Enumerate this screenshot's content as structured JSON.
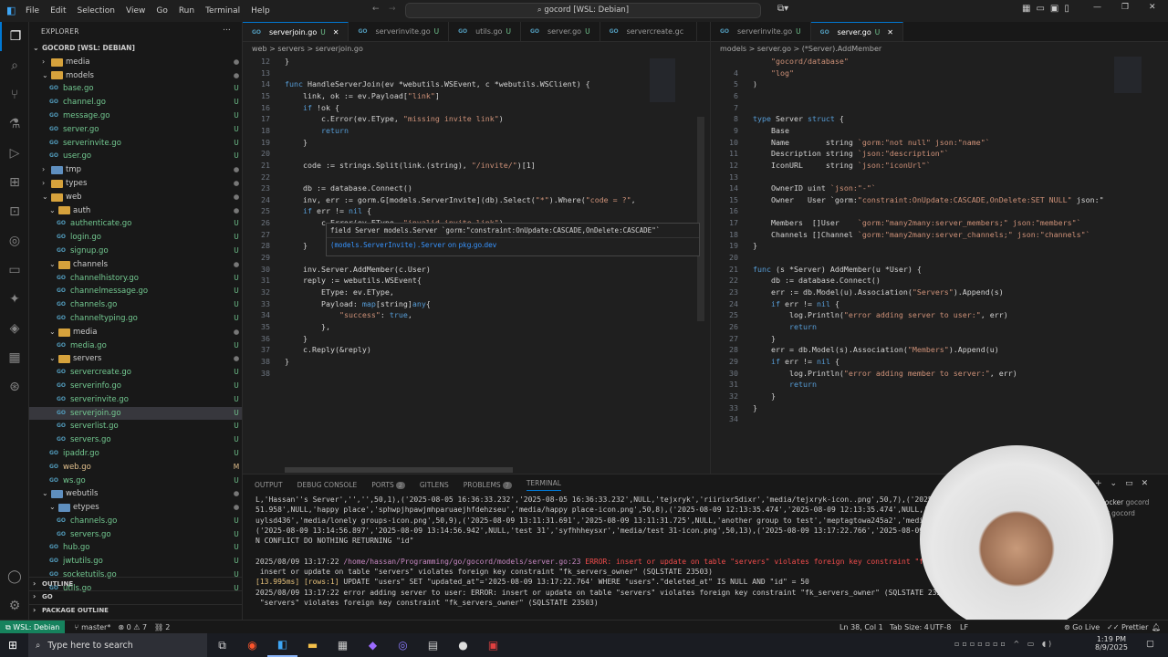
{
  "menu": [
    "File",
    "Edit",
    "Selection",
    "View",
    "Go",
    "Run",
    "Terminal",
    "Help"
  ],
  "search": "gocord [WSL: Debian]",
  "explorer": {
    "title": "EXPLORER",
    "root": "GOCORD [WSL: DEBIAN]",
    "tree": [
      {
        "label": "media",
        "depth": 1,
        "kind": "folder",
        "status": "dot"
      },
      {
        "label": "models",
        "depth": 1,
        "kind": "folder-open",
        "status": "dot"
      },
      {
        "label": "base.go",
        "depth": 2,
        "kind": "go",
        "status": "U"
      },
      {
        "label": "channel.go",
        "depth": 2,
        "kind": "go",
        "status": "U"
      },
      {
        "label": "message.go",
        "depth": 2,
        "kind": "go",
        "status": "U"
      },
      {
        "label": "server.go",
        "depth": 2,
        "kind": "go",
        "status": "U"
      },
      {
        "label": "serverinvite.go",
        "depth": 2,
        "kind": "go",
        "status": "U"
      },
      {
        "label": "user.go",
        "depth": 2,
        "kind": "go",
        "status": "U"
      },
      {
        "label": "tmp",
        "depth": 1,
        "kind": "folder",
        "status": "dot"
      },
      {
        "label": "types",
        "depth": 1,
        "kind": "folder",
        "status": "dot"
      },
      {
        "label": "web",
        "depth": 1,
        "kind": "folder-open",
        "status": "dot"
      },
      {
        "label": "auth",
        "depth": 2,
        "kind": "folder-open",
        "status": "dot"
      },
      {
        "label": "authenticate.go",
        "depth": 3,
        "kind": "go",
        "status": "U"
      },
      {
        "label": "login.go",
        "depth": 3,
        "kind": "go",
        "status": "U"
      },
      {
        "label": "signup.go",
        "depth": 3,
        "kind": "go",
        "status": "U"
      },
      {
        "label": "channels",
        "depth": 2,
        "kind": "folder-open",
        "status": "dot"
      },
      {
        "label": "channelhistory.go",
        "depth": 3,
        "kind": "go",
        "status": "U"
      },
      {
        "label": "channelmessage.go",
        "depth": 3,
        "kind": "go",
        "status": "U"
      },
      {
        "label": "channels.go",
        "depth": 3,
        "kind": "go",
        "status": "U"
      },
      {
        "label": "channeltyping.go",
        "depth": 3,
        "kind": "go",
        "status": "U"
      },
      {
        "label": "media",
        "depth": 2,
        "kind": "folder-open",
        "status": "dot"
      },
      {
        "label": "media.go",
        "depth": 3,
        "kind": "go",
        "status": "U"
      },
      {
        "label": "servers",
        "depth": 2,
        "kind": "folder-open",
        "status": "dot"
      },
      {
        "label": "servercreate.go",
        "depth": 3,
        "kind": "go",
        "status": "U"
      },
      {
        "label": "serverinfo.go",
        "depth": 3,
        "kind": "go",
        "status": "U"
      },
      {
        "label": "serverinvite.go",
        "depth": 3,
        "kind": "go",
        "status": "U"
      },
      {
        "label": "serverjoin.go",
        "depth": 3,
        "kind": "go",
        "status": "U",
        "selected": true
      },
      {
        "label": "serverlist.go",
        "depth": 3,
        "kind": "go",
        "status": "U"
      },
      {
        "label": "servers.go",
        "depth": 3,
        "kind": "go",
        "status": "U"
      },
      {
        "label": "ipaddr.go",
        "depth": 2,
        "kind": "go",
        "status": "U"
      },
      {
        "label": "web.go",
        "depth": 2,
        "kind": "go",
        "status": "M"
      },
      {
        "label": "ws.go",
        "depth": 2,
        "kind": "go",
        "status": "U"
      },
      {
        "label": "webutils",
        "depth": 1,
        "kind": "folder-open",
        "status": "dot"
      },
      {
        "label": "etypes",
        "depth": 2,
        "kind": "folder-open",
        "status": "dot"
      },
      {
        "label": "channels.go",
        "depth": 3,
        "kind": "go",
        "status": "U"
      },
      {
        "label": "servers.go",
        "depth": 3,
        "kind": "go",
        "status": "U"
      },
      {
        "label": "hub.go",
        "depth": 2,
        "kind": "go",
        "status": "U"
      },
      {
        "label": "jwtutils.go",
        "depth": 2,
        "kind": "go",
        "status": "U"
      },
      {
        "label": "socketutils.go",
        "depth": 2,
        "kind": "go",
        "status": "U"
      },
      {
        "label": "utils.go",
        "depth": 2,
        "kind": "go",
        "status": "U"
      }
    ],
    "sections": [
      "OUTLINE",
      "GO",
      "PACKAGE OUTLINE"
    ]
  },
  "left_tabs": [
    {
      "label": "serverjoin.go",
      "mark": "U",
      "active": true
    },
    {
      "label": "serverinvite.go",
      "mark": "U"
    },
    {
      "label": "utils.go",
      "mark": "U"
    },
    {
      "label": "server.go",
      "mark": "U"
    },
    {
      "label": "servercreate.gc",
      "mark": ""
    }
  ],
  "left_crumbs": "web > servers > serverjoin.go",
  "right_tabs": [
    {
      "label": "serverinvite.go",
      "mark": "U"
    },
    {
      "label": "server.go",
      "mark": "U",
      "active": true
    }
  ],
  "right_crumbs": "models > server.go > (*Server).AddMember",
  "left_code": [
    {
      "n": "12",
      "t": "}"
    },
    {
      "n": "13",
      "t": ""
    },
    {
      "n": "14",
      "t": "func HandleServerJoin(ev *webutils.WSEvent, c *webutils.WSClient) {"
    },
    {
      "n": "15",
      "t": "    link, ok := ev.Payload[\"link\"]"
    },
    {
      "n": "16",
      "t": "    if !ok {"
    },
    {
      "n": "17",
      "t": "        c.Error(ev.EType, \"missing invite link\")"
    },
    {
      "n": "18",
      "t": "        return"
    },
    {
      "n": "19",
      "t": "    }"
    },
    {
      "n": "20",
      "t": ""
    },
    {
      "n": "21",
      "t": "    code := strings.Split(link.(string), \"/invite/\")[1]"
    },
    {
      "n": "22",
      "t": ""
    },
    {
      "n": "23",
      "t": "    db := database.Connect()"
    },
    {
      "n": "24",
      "t": "    inv, err := gorm.G[models.ServerInvite](db).Select(\"*\").Where(\"code = ?\","
    },
    {
      "n": "25",
      "t": "    if err != nil {"
    },
    {
      "n": "26",
      "t": "        c.Error(ev.EType, \"invalid invite link\")"
    },
    {
      "n": "27",
      "t": ""
    },
    {
      "n": "28",
      "t": "    }"
    },
    {
      "n": "29",
      "t": ""
    },
    {
      "n": "30",
      "t": "    inv.Server.AddMember(c.User)"
    },
    {
      "n": "31",
      "t": "    reply := webutils.WSEvent{"
    },
    {
      "n": "32",
      "t": "        EType: ev.EType,"
    },
    {
      "n": "33",
      "t": "        Payload: map[string]any{"
    },
    {
      "n": "34",
      "t": "            \"success\": true,"
    },
    {
      "n": "35",
      "t": "        },"
    },
    {
      "n": "36",
      "t": "    }"
    },
    {
      "n": "37",
      "t": "    c.Reply(&reply)"
    },
    {
      "n": "38",
      "t": "}"
    },
    {
      "n": "38",
      "t": ""
    }
  ],
  "hover": {
    "line1": "field Server models.Server `gorm:\"constraint:OnUpdate:CASCADE,OnDelete:CASCADE\"`",
    "line2": "(models.ServerInvite).Server",
    "line2b": " on pkg.go.dev"
  },
  "right_code": [
    {
      "n": "",
      "t": "    \"gocord/database\""
    },
    {
      "n": "4",
      "t": "    \"log\""
    },
    {
      "n": "5",
      "t": ")"
    },
    {
      "n": "6",
      "t": ""
    },
    {
      "n": "7",
      "t": ""
    },
    {
      "n": "8",
      "t": "type Server struct {"
    },
    {
      "n": "9",
      "t": "    Base"
    },
    {
      "n": "10",
      "t": "    Name        string `gorm:\"not null\" json:\"name\"`"
    },
    {
      "n": "11",
      "t": "    Description string `json:\"description\"`"
    },
    {
      "n": "12",
      "t": "    IconURL     string `json:\"iconUrl\"`"
    },
    {
      "n": "13",
      "t": ""
    },
    {
      "n": "14",
      "t": "    OwnerID uint `json:\"-\"`"
    },
    {
      "n": "15",
      "t": "    Owner   User `gorm:\"constraint:OnUpdate:CASCADE,OnDelete:SET NULL\" json:\""
    },
    {
      "n": "16",
      "t": ""
    },
    {
      "n": "17",
      "t": "    Members  []User    `gorm:\"many2many:server_members;\" json:\"members\"`"
    },
    {
      "n": "18",
      "t": "    Channels []Channel `gorm:\"many2many:server_channels;\" json:\"channels\"`"
    },
    {
      "n": "19",
      "t": "}"
    },
    {
      "n": "20",
      "t": ""
    },
    {
      "n": "21",
      "t": "func (s *Server) AddMember(u *User) {"
    },
    {
      "n": "22",
      "t": "    db := database.Connect()"
    },
    {
      "n": "23",
      "t": "    err := db.Model(u).Association(\"Servers\").Append(s)"
    },
    {
      "n": "24",
      "t": "    if err != nil {"
    },
    {
      "n": "25",
      "t": "        log.Println(\"error adding server to user:\", err)"
    },
    {
      "n": "26",
      "t": "        return"
    },
    {
      "n": "27",
      "t": "    }"
    },
    {
      "n": "28",
      "t": "    err = db.Model(s).Association(\"Members\").Append(u)"
    },
    {
      "n": "29",
      "t": "    if err != nil {"
    },
    {
      "n": "30",
      "t": "        log.Println(\"error adding member to server:\", err)"
    },
    {
      "n": "31",
      "t": "        return"
    },
    {
      "n": "32",
      "t": "    }"
    },
    {
      "n": "33",
      "t": "}"
    },
    {
      "n": "34",
      "t": ""
    }
  ],
  "panel": {
    "tabs": [
      "OUTPUT",
      "DEBUG CONSOLE",
      "PORTS",
      "GITLENS",
      "PROBLEMS",
      "TERMINAL"
    ],
    "ports_badge": "2",
    "problems_badge": "7",
    "terminal": [
      "L,'Hassan''s Server','','',50,1),('2025-08-05 16:36:33.232','2025-08-05 16:36:33.232',NULL,'tejxryk','riirixr5dixr','media/tejxryk-icon..png',50,7),('2025-08",
      "51.958',NULL,'happy place','sphwpjhpawjmhparuaejhfdehzseu','media/happy place-icon.png',50,8),('2025-08-09 12:13:35.474','2025-08-09 12:13:35.474',NULL,'lone",
      "uylsd436','media/lonely groups-icon.png',50,9),('2025-08-09 13:11:31.691','2025-08-09 13:11:31.725',NULL,'another group to test','meptagtowa245a2','media/ano",
      "('2025-08-09 13:14:56.897','2025-08-09 13:14:56.942',NULL,'test 31','syfhhheysxr','media/test 31-icon.png',50,13),('2025-08-09 13:17:22.766','2025-08-09 13",
      "N CONFLICT DO NOTHING RETURNING \"id\"",
      "",
      "2025/08/09 13:17:22 /home/hassan/Programming/go/gocord/models/server.go:23 ERROR: insert or update on table \"servers\" violates foreign key constraint \"fk_ser",
      " insert or update on table \"servers\" violates foreign key constraint \"fk_servers_owner\" (SQLSTATE 23503)",
      "[13.995ms] [rows:1] UPDATE \"users\" SET \"updated_at\"='2025-08-09 13:17:22.764' WHERE \"users\".\"deleted_at\" IS NULL AND \"id\" = 50",
      "2025/08/09 13:17:22 error adding server to user: ERROR: insert or update on table \"servers\" violates foreign key constraint \"fk_servers_owner\" (SQLSTATE 23503);",
      " \"servers\" violates foreign key constraint \"fk_servers_owner\" (SQLSTATE 23503)"
    ],
    "side": [
      {
        "icon": "docker",
        "label": "docker",
        "ctx": "gocord"
      },
      {
        "icon": "",
        "label": "air",
        "ctx": "gocord"
      }
    ]
  },
  "status": {
    "remote": "WSL: Debian",
    "branch": "master*",
    "problems": "⊗ 0 ⚠ 7",
    "ports": "2",
    "position": "Ln 38, Col 1",
    "tab": "Tab Size: 4",
    "enc": "UTF-8",
    "eol": "LF",
    "golive": "Go Live",
    "prettier": "Prettier"
  },
  "taskbar": {
    "search": "Type here to search",
    "time": "1:19 PM",
    "date": "8/9/2025"
  }
}
